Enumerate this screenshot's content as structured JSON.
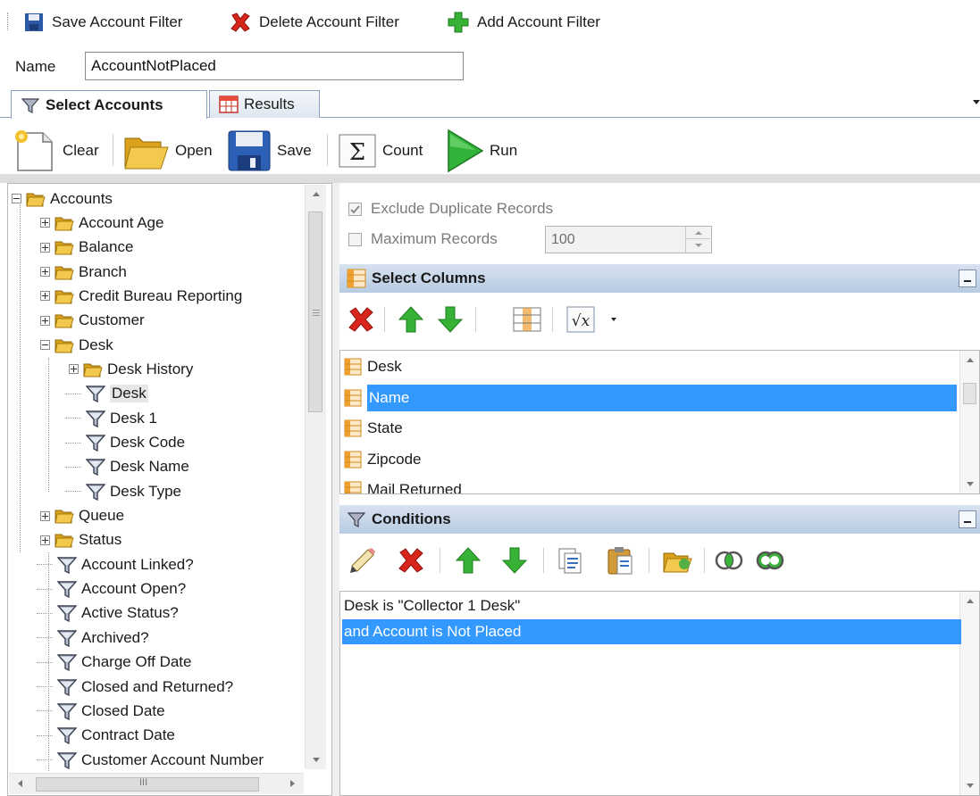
{
  "toolbar": {
    "save_filter": "Save Account Filter",
    "delete_filter": "Delete Account Filter",
    "add_filter": "Add Account Filter"
  },
  "name_field": {
    "label": "Name",
    "value": "AccountNotPlaced"
  },
  "tabs": [
    {
      "label": "Select Accounts",
      "active": true
    },
    {
      "label": "Results",
      "active": false
    }
  ],
  "actions": {
    "clear": "Clear",
    "open": "Open",
    "save": "Save",
    "count": "Count",
    "run": "Run"
  },
  "tree": {
    "root": "Accounts",
    "items": [
      "Account Age",
      "Balance",
      "Branch",
      "Credit Bureau Reporting",
      "Customer",
      "Desk",
      "Desk History",
      "Desk",
      "Desk 1",
      "Desk Code",
      "Desk Name",
      "Desk Type",
      "Queue",
      "Status",
      "Account Linked?",
      "Account Open?",
      "Active Status?",
      "Archived?",
      "Charge Off Date",
      "Closed and Returned?",
      "Closed Date",
      "Contract Date",
      "Customer Account Number"
    ],
    "hscroll_label": "III"
  },
  "options": {
    "exclude_duplicates": "Exclude Duplicate Records",
    "exclude_duplicates_checked": true,
    "max_records": "Maximum Records",
    "max_records_checked": false,
    "max_value": "100"
  },
  "select_columns": {
    "title": "Select Columns",
    "items": [
      "Desk",
      "Name",
      "State",
      "Zipcode",
      "Mail Returned"
    ],
    "selected": "Name"
  },
  "conditions": {
    "title": "Conditions",
    "items": [
      "Desk is \"Collector 1 Desk\"",
      "and Account is Not Placed"
    ],
    "selected": "and Account is Not Placed"
  },
  "colors": {
    "selection": "#3399ff",
    "header": "#b8cbe2",
    "folder": "#e8b527",
    "red_x": "#d8261c",
    "green_arrow": "#37b236"
  }
}
